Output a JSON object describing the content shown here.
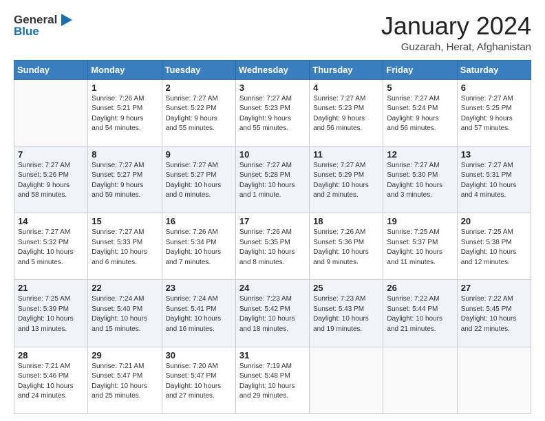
{
  "header": {
    "logo_line1": "General",
    "logo_line2": "Blue",
    "month": "January 2024",
    "location": "Guzarah, Herat, Afghanistan"
  },
  "weekdays": [
    "Sunday",
    "Monday",
    "Tuesday",
    "Wednesday",
    "Thursday",
    "Friday",
    "Saturday"
  ],
  "weeks": [
    [
      {
        "day": "",
        "sunrise": "",
        "sunset": "",
        "daylight": ""
      },
      {
        "day": "1",
        "sunrise": "7:26 AM",
        "sunset": "5:21 PM",
        "daylight": "9 hours and 54 minutes."
      },
      {
        "day": "2",
        "sunrise": "7:27 AM",
        "sunset": "5:22 PM",
        "daylight": "9 hours and 55 minutes."
      },
      {
        "day": "3",
        "sunrise": "7:27 AM",
        "sunset": "5:23 PM",
        "daylight": "9 hours and 55 minutes."
      },
      {
        "day": "4",
        "sunrise": "7:27 AM",
        "sunset": "5:23 PM",
        "daylight": "9 hours and 56 minutes."
      },
      {
        "day": "5",
        "sunrise": "7:27 AM",
        "sunset": "5:24 PM",
        "daylight": "9 hours and 56 minutes."
      },
      {
        "day": "6",
        "sunrise": "7:27 AM",
        "sunset": "5:25 PM",
        "daylight": "9 hours and 57 minutes."
      }
    ],
    [
      {
        "day": "7",
        "sunrise": "7:27 AM",
        "sunset": "5:26 PM",
        "daylight": "9 hours and 58 minutes."
      },
      {
        "day": "8",
        "sunrise": "7:27 AM",
        "sunset": "5:27 PM",
        "daylight": "9 hours and 59 minutes."
      },
      {
        "day": "9",
        "sunrise": "7:27 AM",
        "sunset": "5:27 PM",
        "daylight": "10 hours and 0 minutes."
      },
      {
        "day": "10",
        "sunrise": "7:27 AM",
        "sunset": "5:28 PM",
        "daylight": "10 hours and 1 minute."
      },
      {
        "day": "11",
        "sunrise": "7:27 AM",
        "sunset": "5:29 PM",
        "daylight": "10 hours and 2 minutes."
      },
      {
        "day": "12",
        "sunrise": "7:27 AM",
        "sunset": "5:30 PM",
        "daylight": "10 hours and 3 minutes."
      },
      {
        "day": "13",
        "sunrise": "7:27 AM",
        "sunset": "5:31 PM",
        "daylight": "10 hours and 4 minutes."
      }
    ],
    [
      {
        "day": "14",
        "sunrise": "7:27 AM",
        "sunset": "5:32 PM",
        "daylight": "10 hours and 5 minutes."
      },
      {
        "day": "15",
        "sunrise": "7:27 AM",
        "sunset": "5:33 PM",
        "daylight": "10 hours and 6 minutes."
      },
      {
        "day": "16",
        "sunrise": "7:26 AM",
        "sunset": "5:34 PM",
        "daylight": "10 hours and 7 minutes."
      },
      {
        "day": "17",
        "sunrise": "7:26 AM",
        "sunset": "5:35 PM",
        "daylight": "10 hours and 8 minutes."
      },
      {
        "day": "18",
        "sunrise": "7:26 AM",
        "sunset": "5:36 PM",
        "daylight": "10 hours and 9 minutes."
      },
      {
        "day": "19",
        "sunrise": "7:25 AM",
        "sunset": "5:37 PM",
        "daylight": "10 hours and 11 minutes."
      },
      {
        "day": "20",
        "sunrise": "7:25 AM",
        "sunset": "5:38 PM",
        "daylight": "10 hours and 12 minutes."
      }
    ],
    [
      {
        "day": "21",
        "sunrise": "7:25 AM",
        "sunset": "5:39 PM",
        "daylight": "10 hours and 13 minutes."
      },
      {
        "day": "22",
        "sunrise": "7:24 AM",
        "sunset": "5:40 PM",
        "daylight": "10 hours and 15 minutes."
      },
      {
        "day": "23",
        "sunrise": "7:24 AM",
        "sunset": "5:41 PM",
        "daylight": "10 hours and 16 minutes."
      },
      {
        "day": "24",
        "sunrise": "7:23 AM",
        "sunset": "5:42 PM",
        "daylight": "10 hours and 18 minutes."
      },
      {
        "day": "25",
        "sunrise": "7:23 AM",
        "sunset": "5:43 PM",
        "daylight": "10 hours and 19 minutes."
      },
      {
        "day": "26",
        "sunrise": "7:22 AM",
        "sunset": "5:44 PM",
        "daylight": "10 hours and 21 minutes."
      },
      {
        "day": "27",
        "sunrise": "7:22 AM",
        "sunset": "5:45 PM",
        "daylight": "10 hours and 22 minutes."
      }
    ],
    [
      {
        "day": "28",
        "sunrise": "7:21 AM",
        "sunset": "5:46 PM",
        "daylight": "10 hours and 24 minutes."
      },
      {
        "day": "29",
        "sunrise": "7:21 AM",
        "sunset": "5:47 PM",
        "daylight": "10 hours and 25 minutes."
      },
      {
        "day": "30",
        "sunrise": "7:20 AM",
        "sunset": "5:47 PM",
        "daylight": "10 hours and 27 minutes."
      },
      {
        "day": "31",
        "sunrise": "7:19 AM",
        "sunset": "5:48 PM",
        "daylight": "10 hours and 29 minutes."
      },
      {
        "day": "",
        "sunrise": "",
        "sunset": "",
        "daylight": ""
      },
      {
        "day": "",
        "sunrise": "",
        "sunset": "",
        "daylight": ""
      },
      {
        "day": "",
        "sunrise": "",
        "sunset": "",
        "daylight": ""
      }
    ]
  ],
  "labels": {
    "sunrise": "Sunrise:",
    "sunset": "Sunset:",
    "daylight": "Daylight:"
  }
}
